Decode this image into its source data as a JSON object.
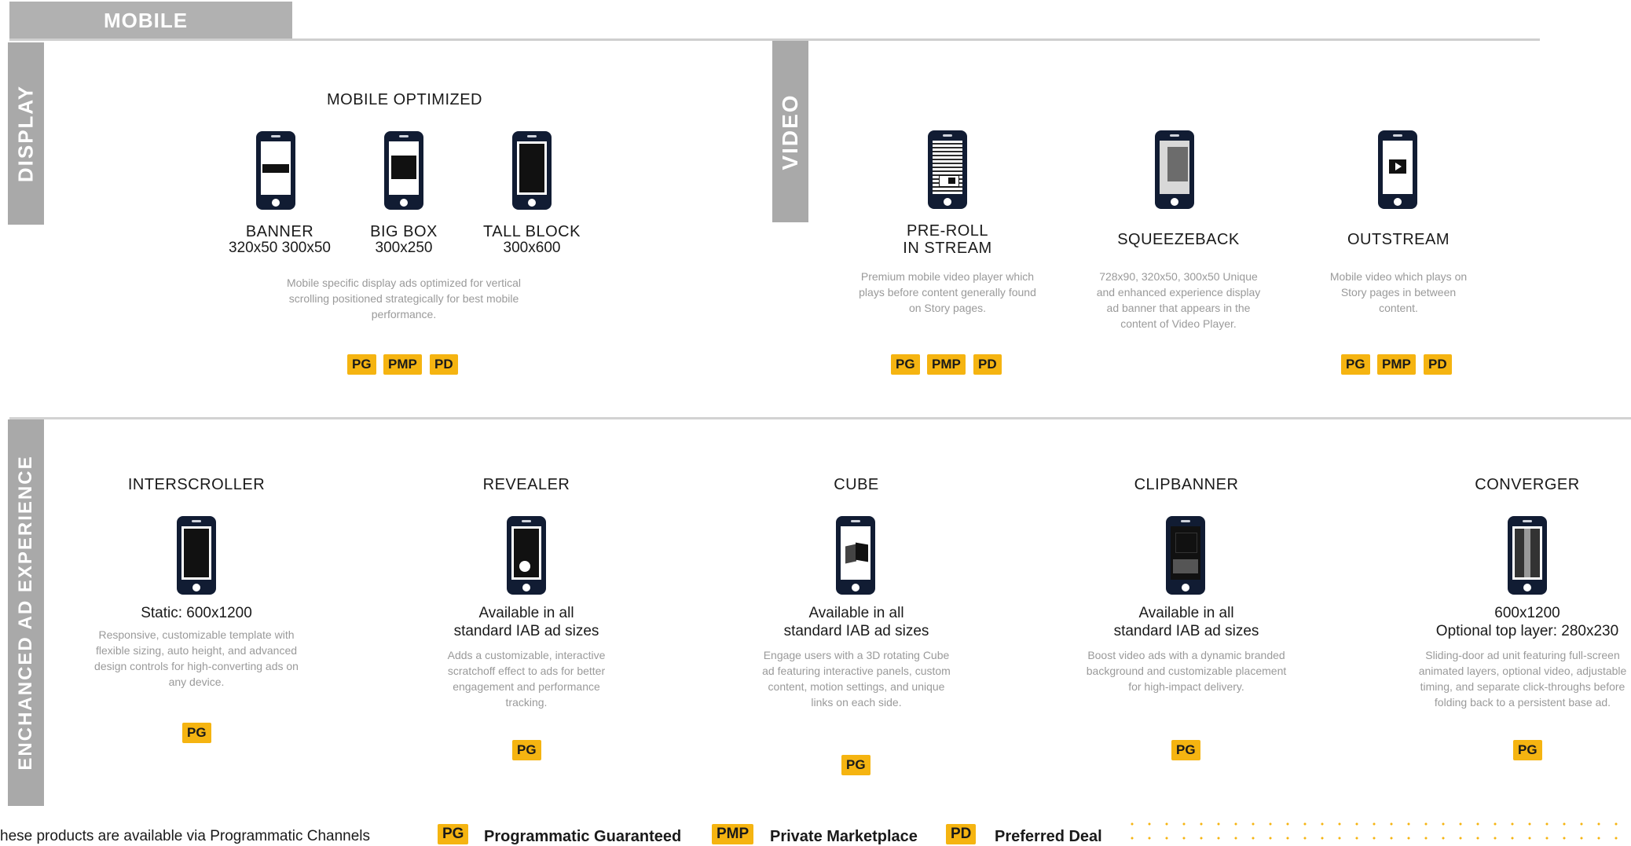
{
  "header": {
    "tab_label": "MOBILE"
  },
  "sections": {
    "display": "DISPLAY",
    "video": "VIDEO",
    "enhanced": "ENCHANCED AD EXPERIENCE"
  },
  "display": {
    "heading": "MOBILE OPTIMIZED",
    "items": [
      {
        "title": "BANNER",
        "size": "320x50 300x50",
        "icon": "phone-banner-icon"
      },
      {
        "title": "BIG BOX",
        "size": "300x250",
        "icon": "phone-bigbox-icon"
      },
      {
        "title": "TALL BLOCK",
        "size": "300x600",
        "icon": "phone-tallblock-icon"
      }
    ],
    "description": "Mobile specific display ads optimized for vertical scrolling positioned strategically for best mobile performance.",
    "badges": [
      "PG",
      "PMP",
      "PD"
    ]
  },
  "video": {
    "items": [
      {
        "title_line1": "PRE-ROLL",
        "title_line2": "IN STREAM",
        "description": "Premium mobile video player which plays before content generally found on Story pages.",
        "badges": [
          "PG",
          "PMP",
          "PD"
        ],
        "icon": "phone-preroll-icon"
      },
      {
        "title_line1": "SQUEEZEBACK",
        "description": "728x90, 320x50, 300x50 Unique and enhanced experience display ad banner that appears in the content of Video Player.",
        "badges": [],
        "icon": "phone-squeezeback-icon"
      },
      {
        "title_line1": "OUTSTREAM",
        "description": "Mobile video which plays on Story pages in between content.",
        "badges": [
          "PG",
          "PMP",
          "PD"
        ],
        "icon": "phone-outstream-icon"
      }
    ]
  },
  "enhanced": {
    "items": [
      {
        "title": "INTERSCROLLER",
        "size_line1": "Static: 600x1200",
        "size_line2": "",
        "description": "Responsive, customizable template with flexible sizing, auto height, and advanced design controls for high-converting ads on any device.",
        "badge": "PG",
        "icon": "phone-interscroller-icon"
      },
      {
        "title": "REVEALER",
        "size_line1": "Available in all",
        "size_line2": "standard IAB ad sizes",
        "description": "Adds a customizable, interactive scratchoff effect to ads for better engagement and performance tracking.",
        "badge": "PG",
        "icon": "phone-revealer-icon"
      },
      {
        "title": "CUBE",
        "size_line1": "Available in all",
        "size_line2": "standard IAB ad sizes",
        "description": "Engage users with a 3D rotating Cube ad featuring interactive panels, custom content, motion settings, and unique links on each side.",
        "badge": "PG",
        "icon": "phone-cube-icon"
      },
      {
        "title": "CLIPBANNER",
        "size_line1": "Available in all",
        "size_line2": "standard IAB ad sizes",
        "description": "Boost video ads with a dynamic branded background and customizable placement for high-impact delivery.",
        "badge": "PG",
        "icon": "phone-clipbanner-icon"
      },
      {
        "title": "CONVERGER",
        "size_line1": "600x1200",
        "size_line2": "Optional top layer: 280x230",
        "description": "Sliding-door ad unit featuring full-screen animated layers, optional video, adjustable timing, and separate click-throughs before folding back to a persistent base ad.",
        "badge": "PG",
        "icon": "phone-converger-icon"
      }
    ]
  },
  "footer": {
    "note": "hese products are available via Programmatic Channels",
    "legend": [
      {
        "code": "PG",
        "label": "Programmatic Guaranteed"
      },
      {
        "code": "PMP",
        "label": "Private Marketplace"
      },
      {
        "code": "PD",
        "label": "Preferred Deal"
      }
    ]
  },
  "colors": {
    "badge": "#f5b411",
    "phone": "#111c33",
    "side_label": "#a9a9a9"
  }
}
